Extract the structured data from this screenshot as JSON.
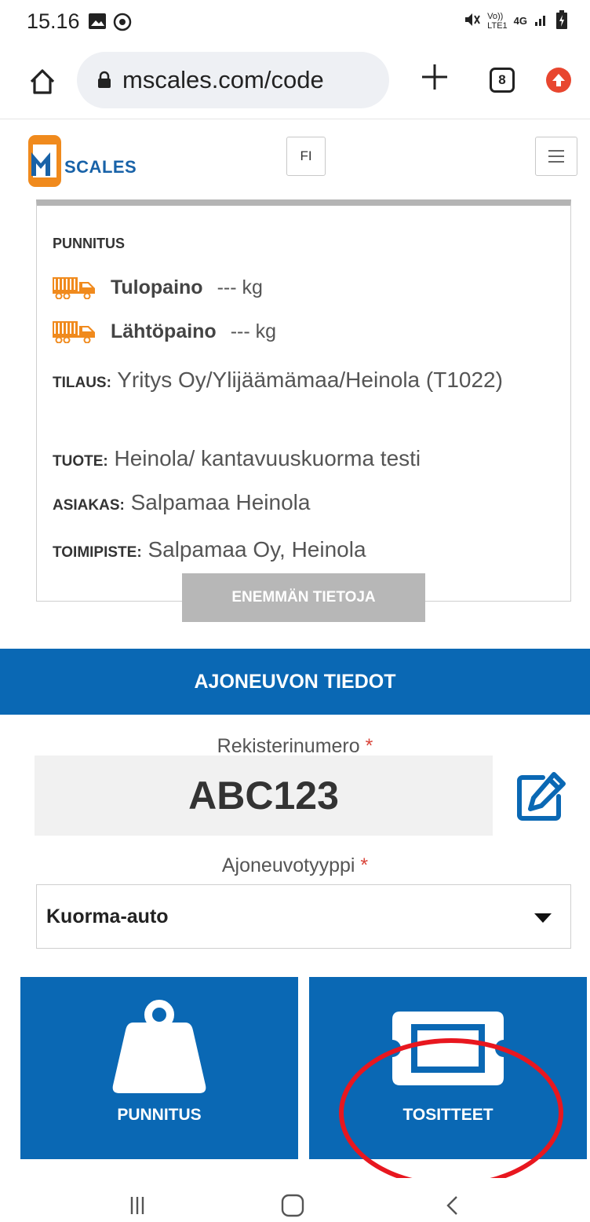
{
  "status_bar": {
    "time": "15.16",
    "network": "4G",
    "lte": "LTE1",
    "volte": "Vo))"
  },
  "browser": {
    "url": "mscales.com/code",
    "tab_count": "8"
  },
  "header": {
    "logo_text": "SCALES",
    "language": "FI"
  },
  "weighing_card": {
    "title": "PUNNITUS",
    "entry_weight_label": "Tulopaino",
    "entry_weight_value": "--- kg",
    "exit_weight_label": "Lähtöpaino",
    "exit_weight_value": "--- kg",
    "order_key": "TILAUS:",
    "order_value": " Yritys Oy/Ylijäämämaa/Heinola (T1022)",
    "product_key": "TUOTE:",
    "product_value": " Heinola/ kantavuuskuorma testi",
    "customer_key": "ASIAKAS:",
    "customer_value": " Salpamaa Heinola",
    "office_key": "TOIMIPISTE:",
    "office_value": " Salpamaa Oy, Heinola",
    "more_button": "ENEMMÄN TIETOJA"
  },
  "vehicle_section": {
    "title": "AJONEUVON TIEDOT",
    "reg_label": "Rekisterinumero",
    "required_mark": "*",
    "reg_value": "ABC123",
    "type_label": "Ajoneuvotyyppi",
    "type_value": "Kuorma-auto"
  },
  "actions": {
    "weighing": "PUNNITUS",
    "documents": "TOSITTEET"
  },
  "colors": {
    "primary": "#0a68b4",
    "logo_orange": "#f08a1d",
    "annotation_red": "#e8171f"
  }
}
